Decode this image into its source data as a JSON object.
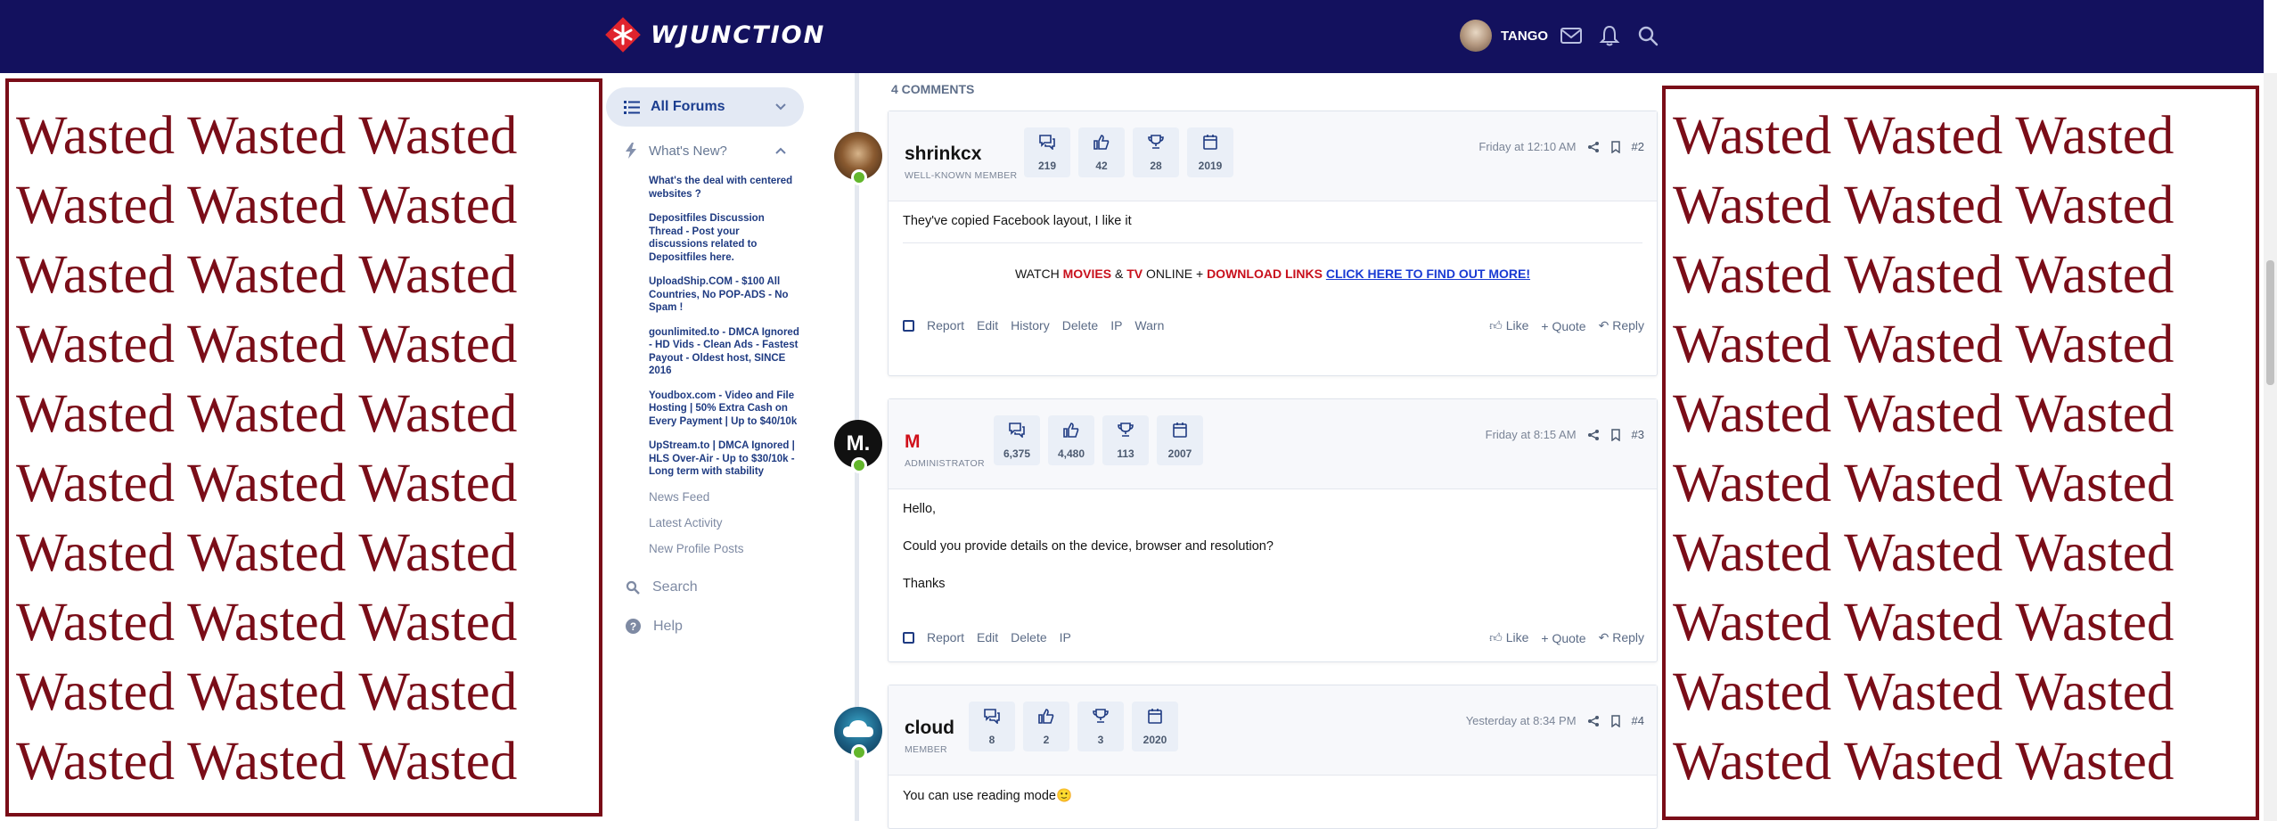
{
  "header": {
    "brand": "WJUNCTION",
    "username": "TANGO",
    "icons": [
      "envelope-icon",
      "bell-icon",
      "search-icon"
    ],
    "color": "#13115e"
  },
  "ads": {
    "text": "Wasted Wasted Wasted",
    "color": "#7a0d18",
    "left_rows": 10,
    "right_rows": 10
  },
  "sidebar": {
    "all_forums": "All Forums",
    "whats_new": "What's New?",
    "threads": [
      "What's the deal with centered websites ?",
      "Depositfiles Discussion Thread - Post your discussions related to Depositfiles here.",
      "UploadShip.COM - $100 All Countries, No POP-ADS - No Spam !",
      "gounlimited.to - DMCA Ignored - HD Vids - Clean Ads - Fastest Payout - Oldest host, SINCE 2016",
      "Youdbox.com - Video and File Hosting | 50% Extra Cash on Every Payment | Up to $40/10k",
      "UpStream.to | DMCA Ignored | HLS Over-Air - Up to $30/10k - Long term with stability"
    ],
    "links": [
      "News Feed",
      "Latest Activity",
      "New Profile Posts"
    ],
    "search": "Search",
    "help": "Help"
  },
  "comments_count": "4 COMMENTS",
  "posts": [
    {
      "name": "shrinkcx",
      "role": "WELL-KNOWN MEMBER",
      "stats": [
        "219",
        "42",
        "28",
        "2019"
      ],
      "date": "Friday at 12:10 AM",
      "num": "#2",
      "body": [
        "They've copied Facebook layout, I like it"
      ],
      "promo": {
        "p1": "WATCH ",
        "movies": "MOVIES",
        "amp": " & ",
        "tv": "TV",
        "p2": " ONLINE + ",
        "dl": "DOWNLOAD LINKS",
        "link": "CLICK HERE TO FIND OUT MORE!"
      },
      "actions": [
        "Report",
        "Edit",
        "History",
        "Delete",
        "IP",
        "Warn"
      ]
    },
    {
      "name": "M",
      "role": "ADMINISTRATOR",
      "avatar_text": "M.",
      "stats": [
        "6,375",
        "4,480",
        "113",
        "2007"
      ],
      "date": "Friday at 8:15 AM",
      "num": "#3",
      "body": [
        "Hello,",
        "Could you provide details on the device, browser and resolution?",
        "Thanks"
      ],
      "actions": [
        "Report",
        "Edit",
        "Delete",
        "IP"
      ]
    },
    {
      "name": "cloud",
      "role": "MEMBER",
      "stats": [
        "8",
        "2",
        "3",
        "2020"
      ],
      "date": "Yesterday at 8:34 PM",
      "num": "#4",
      "body": [
        "You can use reading mode🙂"
      ]
    }
  ],
  "post_actions_right": [
    "Like",
    "+ Quote",
    "Reply"
  ]
}
